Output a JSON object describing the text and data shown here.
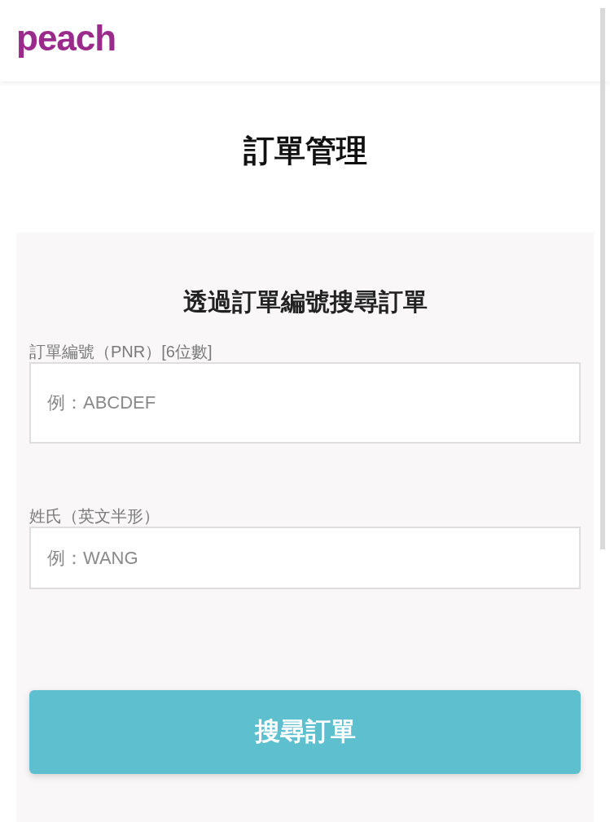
{
  "header": {
    "logo": "peach"
  },
  "page_title": "訂單管理",
  "search_panel": {
    "heading": "透過訂單編號搜尋訂單",
    "fields": [
      {
        "label": "訂單編號（PNR）[6位數]",
        "placeholder": "例：ABCDEF"
      },
      {
        "label": "姓氏（英文半形）",
        "placeholder": "例：WANG"
      }
    ],
    "submit_button": "搜尋訂單"
  }
}
